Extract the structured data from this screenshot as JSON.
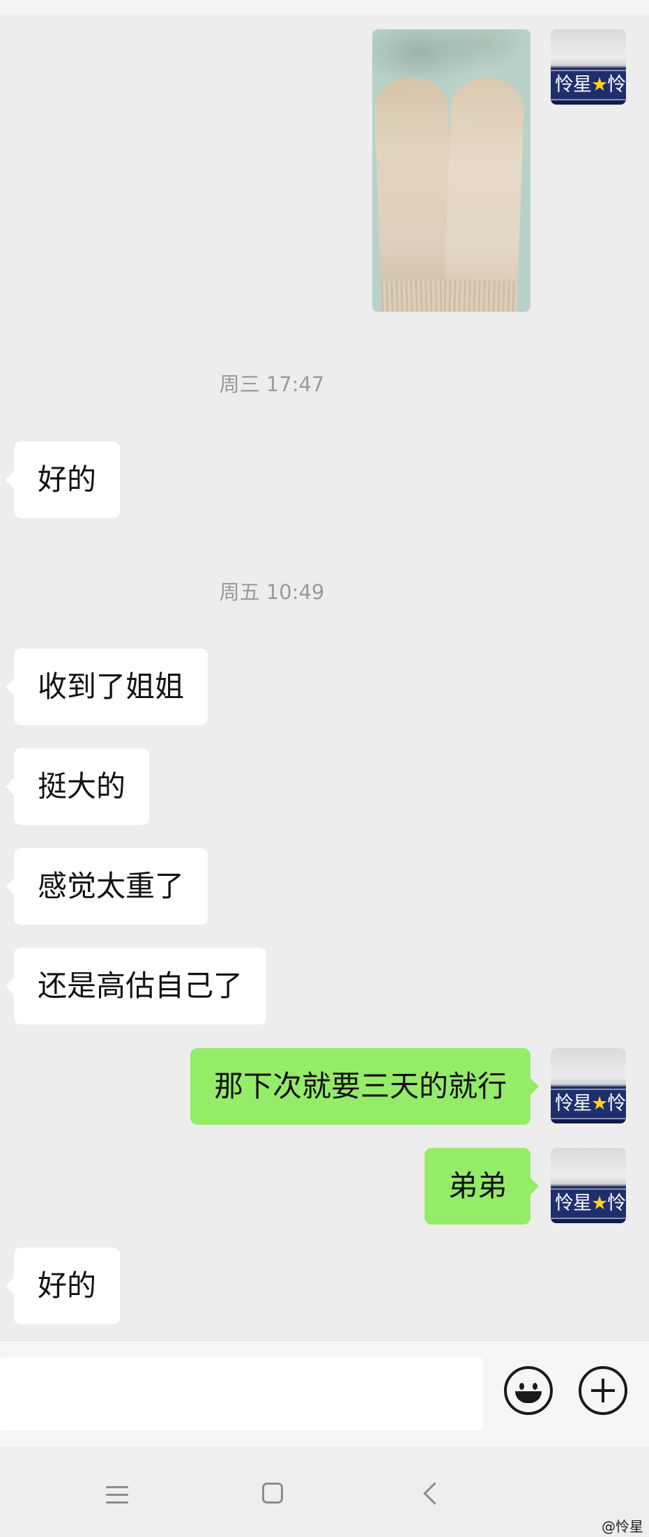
{
  "avatar": {
    "label": "怜星",
    "star": "★",
    "label_tail": "怜"
  },
  "messages": [
    {
      "type": "image",
      "side": "out",
      "content_desc": ""
    },
    {
      "type": "time",
      "text": "周三 17:47"
    },
    {
      "type": "text",
      "side": "in",
      "text": "好的"
    },
    {
      "type": "time",
      "text": "周五 10:49"
    },
    {
      "type": "text",
      "side": "in",
      "text": "收到了姐姐"
    },
    {
      "type": "text",
      "side": "in",
      "text": "挺大的"
    },
    {
      "type": "text",
      "side": "in",
      "text": "感觉太重了"
    },
    {
      "type": "text",
      "side": "in",
      "text": "还是高估自己了"
    },
    {
      "type": "text",
      "side": "out",
      "text": "那下次就要三天的就行"
    },
    {
      "type": "text",
      "side": "out",
      "text": "弟弟"
    },
    {
      "type": "text",
      "side": "in",
      "text": "好的"
    }
  ],
  "input": {
    "placeholder": ""
  },
  "toolbar": {
    "emoji_icon": "smiley-icon",
    "more_icon": "plus-circle-icon"
  },
  "nav": {
    "menu_icon": "menu-icon",
    "home_icon": "home-square-icon",
    "back_icon": "back-chevron-icon"
  },
  "watermark": "@怜星",
  "colors": {
    "background": "#ededed",
    "incoming_bubble": "#ffffff",
    "outgoing_bubble": "#95ec69",
    "timestamp": "#9a9a9a"
  }
}
